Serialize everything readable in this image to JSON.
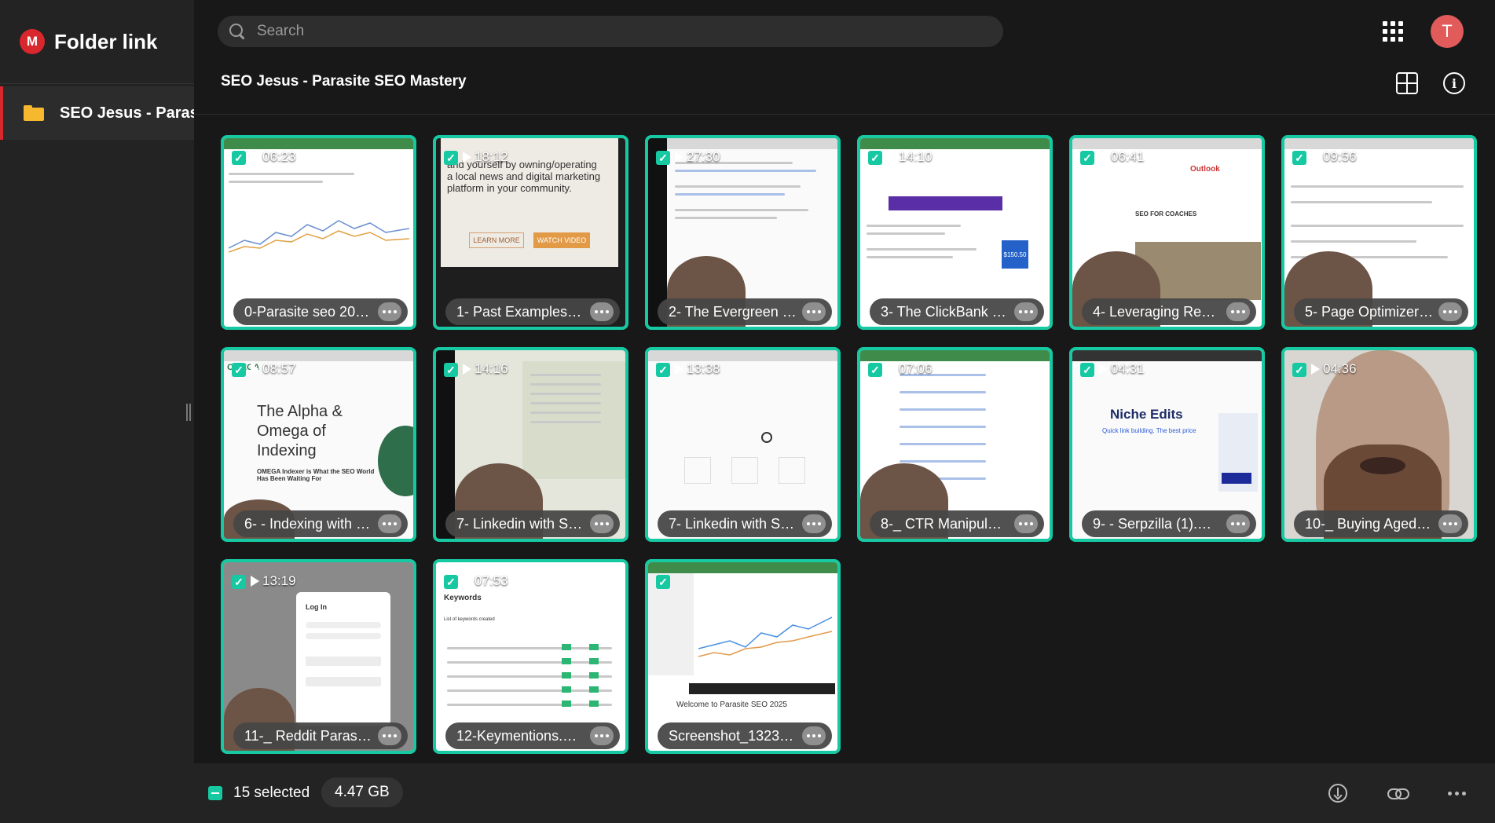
{
  "app": {
    "brand_initial": "M",
    "title": "Folder link"
  },
  "sidebar": {
    "items": [
      {
        "label": "SEO Jesus - Parasite SEO Mastery",
        "icon": "folder-icon"
      }
    ]
  },
  "search": {
    "placeholder": "Search"
  },
  "user": {
    "avatar_initial": "T"
  },
  "breadcrumb": "SEO Jesus - Parasite SEO Mastery",
  "colors": {
    "accent": "#17c9a3",
    "brand": "#d9272e",
    "avatar": "#e15b5b",
    "folder": "#f5b82e",
    "background": "#181818"
  },
  "files": [
    {
      "name": "0-Parasite seo 2025.mp4",
      "display": "0-Parasite seo 202...",
      "duration": "06:23",
      "type": "video",
      "selected": true
    },
    {
      "name": "1- Past Examples of...",
      "display": "1- Past Examples of...",
      "duration": "18:12",
      "type": "video",
      "selected": true
    },
    {
      "name": "2- The Evergreen E...",
      "display": "2- The Evergreen E...",
      "duration": "27:30",
      "type": "video",
      "selected": true
    },
    {
      "name": "3- The ClickBank M...",
      "display": "3- The ClickBank M...",
      "duration": "14:10",
      "type": "video",
      "selected": true
    },
    {
      "name": "4- Leveraging Resel...",
      "display": "4- Leveraging Resel...",
      "duration": "06:41",
      "type": "video",
      "selected": true
    },
    {
      "name": "5- Page Optimizer P...",
      "display": "5- Page Optimizer P...",
      "duration": "09:56",
      "type": "video",
      "selected": true
    },
    {
      "name": "6- - Indexing with O...",
      "display": "6- - Indexing with O...",
      "duration": "08:57",
      "type": "video",
      "selected": true
    },
    {
      "name": "7- Linkedin with Sur...",
      "display": "7- Linkedin with Sur...",
      "duration": "14:16",
      "type": "video",
      "selected": true
    },
    {
      "name": "7- Linkedin with Sur...",
      "display": "7- Linkedin with Sur...",
      "duration": "13:38",
      "type": "video",
      "selected": true
    },
    {
      "name": "8-_ CTR Manipulatio...",
      "display": "8-_ CTR Manipulatio...",
      "duration": "07:06",
      "type": "video",
      "selected": true
    },
    {
      "name": "9- - Serpzilla (1).mp4",
      "display": "9- - Serpzilla (1).mp4",
      "duration": "04:31",
      "type": "video",
      "selected": true
    },
    {
      "name": "10-_ Buying Aged R...",
      "display": "10-_ Buying Aged R...",
      "duration": "04:36",
      "type": "video",
      "selected": true
    },
    {
      "name": "11-_ Reddit Parasite ...",
      "display": "11-_ Reddit Parasite ...",
      "duration": "13:19",
      "type": "video",
      "selected": true
    },
    {
      "name": "12-Keymentions.mp4",
      "display": "12-Keymentions.mp4",
      "duration": "07:53",
      "type": "video",
      "selected": true
    },
    {
      "name": "Screenshot_1323.jpg",
      "display": "Screenshot_1323.jpg",
      "duration": "",
      "type": "image",
      "selected": true
    }
  ],
  "thumb_texts": {
    "past_examples": "and yourself by owning/operating a local news and digital marketing platform in your community.",
    "learn_more": "LEARN MORE",
    "watch_video": "WATCH VIDEO",
    "omega_logo": "OMEGA",
    "omega_headline": "The Alpha & Omega of Indexing",
    "omega_sub": "OMEGA Indexer is What the SEO World Has Been Waiting For",
    "niche_title": "Niche Edits",
    "niche_sub": "Quick link building. The best price",
    "seo_coaches": "SEO FOR COACHES",
    "outlook": "Outlook",
    "login": "Log In",
    "keywords": "Keywords",
    "keywords_list": "List of keywords created",
    "welcome": "Welcome to Parasite SEO 2025",
    "price": "$150.50"
  },
  "footer": {
    "selected_label": "15 selected",
    "total_size": "4.47 GB"
  }
}
